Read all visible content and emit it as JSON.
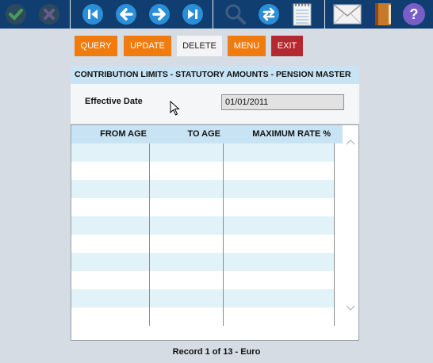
{
  "toolbar": {
    "icons": [
      "check-icon",
      "cancel-icon",
      "first-record-icon",
      "previous-icon",
      "next-icon",
      "last-record-icon",
      "search-icon",
      "refresh-icon",
      "notepad-icon",
      "mail-icon",
      "book-icon",
      "help-icon"
    ],
    "help_glyph": "?"
  },
  "actions": {
    "query": "QUERY",
    "update": "UPDATE",
    "delete": "DELETE",
    "menu": "MENU",
    "exit": "EXIT"
  },
  "panel": {
    "title": "CONTRIBUTION LIMITS - STATUTORY AMOUNTS - PENSION MASTER",
    "effective_date_label": "Effective Date",
    "effective_date_value": "01/01/2011"
  },
  "grid": {
    "columns": [
      "FROM AGE",
      "TO AGE",
      "MAXIMUM RATE %"
    ],
    "rows": [
      [
        "",
        "",
        ""
      ],
      [
        "",
        "",
        ""
      ],
      [
        "",
        "",
        ""
      ],
      [
        "",
        "",
        ""
      ],
      [
        "",
        "",
        ""
      ],
      [
        "",
        "",
        ""
      ],
      [
        "",
        "",
        ""
      ],
      [
        "",
        "",
        ""
      ],
      [
        "",
        "",
        ""
      ],
      [
        "",
        "",
        ""
      ]
    ]
  },
  "footer": {
    "record_status": "Record 1 of 13 - Euro"
  },
  "colors": {
    "toolbar_bg": "#113e70",
    "orange_button": "#f07c10",
    "red_button": "#b22a2f",
    "header_bg": "#c8e4f4",
    "row_alt": "#e1f3f8"
  }
}
